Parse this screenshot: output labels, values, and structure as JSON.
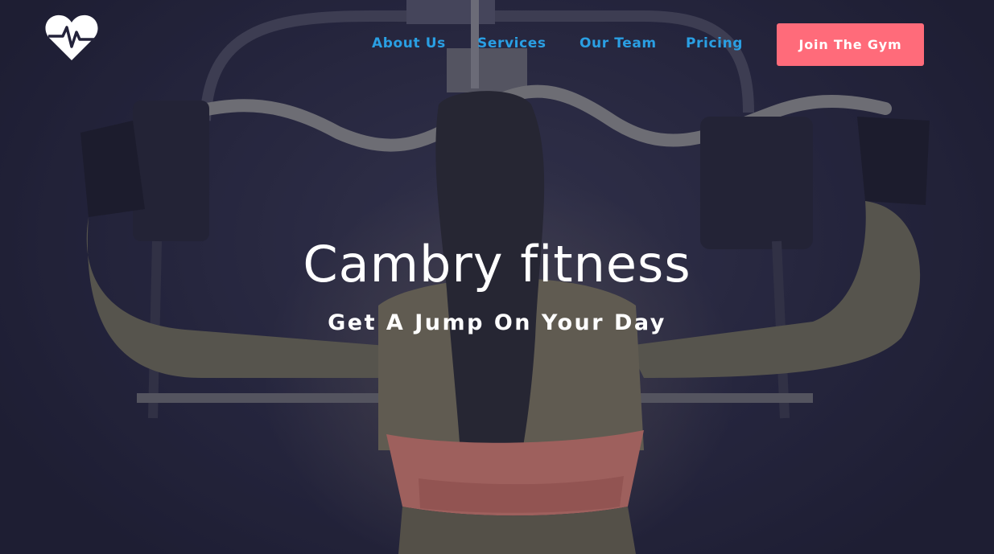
{
  "brand": {
    "logo_icon": "heart-pulse-icon",
    "logo_color": "#ffffff"
  },
  "nav": {
    "items": [
      {
        "label": "About Us"
      },
      {
        "label": "Services"
      },
      {
        "label": "Our Team"
      },
      {
        "label": "Pricing"
      }
    ],
    "link_color": "#2a9fe3"
  },
  "cta": {
    "label": "Join The Gym",
    "color": "#ff6b7a"
  },
  "hero": {
    "title": "Cambry fitness",
    "subtitle": "Get A Jump On Your Day",
    "background_description_icon": "gym-workout-photo",
    "overlay_color": "#23223a"
  }
}
